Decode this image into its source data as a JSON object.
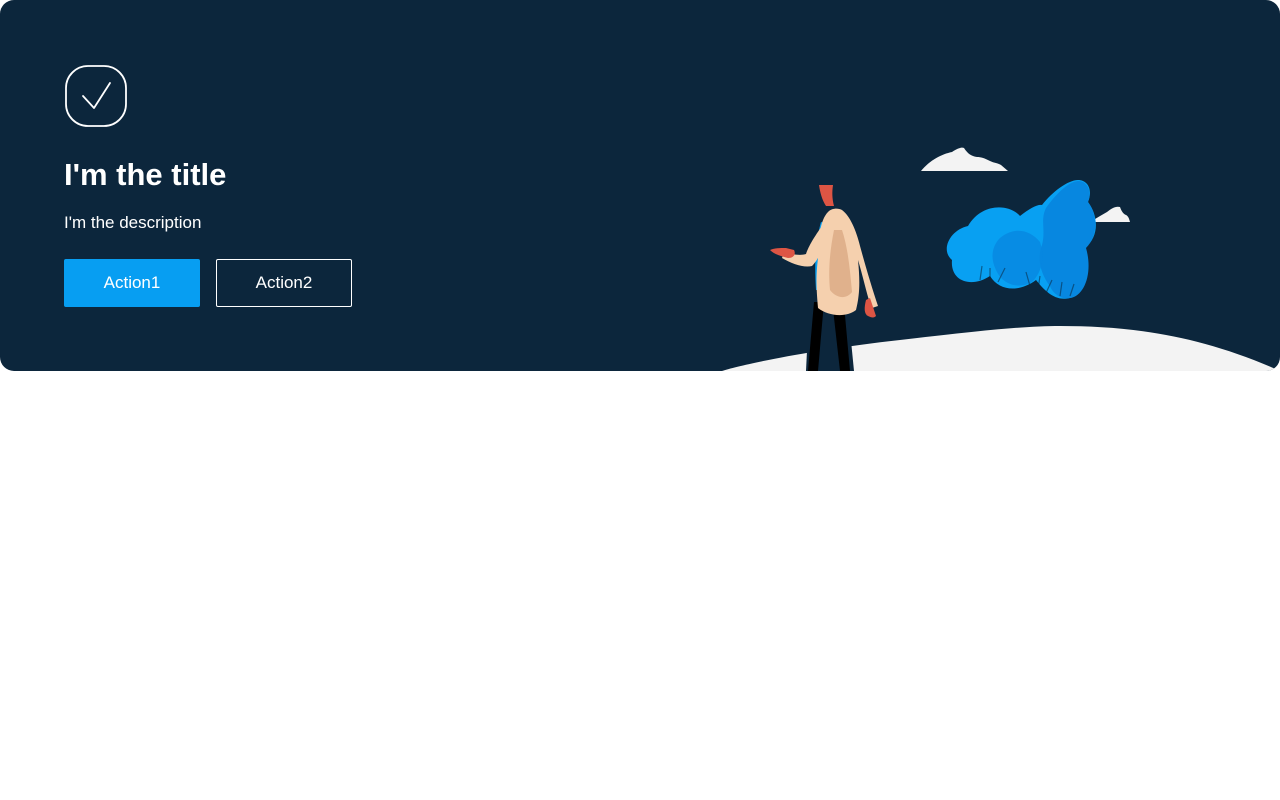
{
  "banner": {
    "icon": "check-icon",
    "title": "I'm the title",
    "description": "I'm the description",
    "actions": [
      {
        "label": "Action1",
        "style": "primary"
      },
      {
        "label": "Action2",
        "style": "secondary"
      }
    ]
  },
  "colors": {
    "background": "#0c263c",
    "primary": "#079ef2",
    "text": "#ffffff",
    "ground": "#f3f3f3"
  }
}
